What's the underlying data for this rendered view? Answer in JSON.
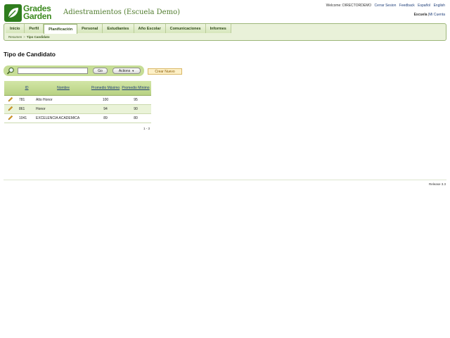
{
  "brand": {
    "line1": "Grades",
    "line2": "Garden",
    "logo_icon": "leaf-logo-icon",
    "color": "#3c8a1f"
  },
  "app_title": "Adiestramientos (Escuela Demo)",
  "top_links": {
    "welcome": "Welcome: DIRECTORDEMO",
    "logout": "Cerrar Sesion",
    "feedback": "Feedback",
    "spanish": "Español",
    "english": "English"
  },
  "user_links": {
    "school": "Escuela",
    "separator": "|",
    "my_account": "Mi Cuenta"
  },
  "tabs": [
    {
      "label": "Inicio",
      "active": false
    },
    {
      "label": "Perfil",
      "active": false
    },
    {
      "label": "Planificación",
      "active": true
    },
    {
      "label": "Personal",
      "active": false
    },
    {
      "label": "Estudiantes",
      "active": false
    },
    {
      "label": "Año Escolar",
      "active": false
    },
    {
      "label": "Comunicaciones",
      "active": false
    },
    {
      "label": "Informes",
      "active": false
    }
  ],
  "breadcrumb": {
    "root": "Resumen",
    "separator": ">",
    "current": "Tipo Candidato"
  },
  "page_title": "Tipo de Candidato",
  "search": {
    "value": "",
    "placeholder": "",
    "go_label": "Go",
    "actions_label": "Actions"
  },
  "new_button_label": "Crear Nuevo",
  "table": {
    "headers": {
      "id": "ID",
      "name": "Nombre",
      "max": "Promedio Máximo",
      "min": "Promedio Mínimo"
    },
    "rows": [
      {
        "id": "781",
        "name": "Alto Honor",
        "max": "100",
        "min": "95"
      },
      {
        "id": "861",
        "name": "Honor",
        "max": "94",
        "min": "90"
      },
      {
        "id": "1041",
        "name": "EXCELENCIA ACADEMICA",
        "max": "89",
        "min": "80"
      }
    ]
  },
  "pager": "1 - 3",
  "release": "Release 3.3",
  "colors": {
    "accent": "#c6dd96",
    "header_green": "#b8d283",
    "link": "#1f3f7a"
  }
}
